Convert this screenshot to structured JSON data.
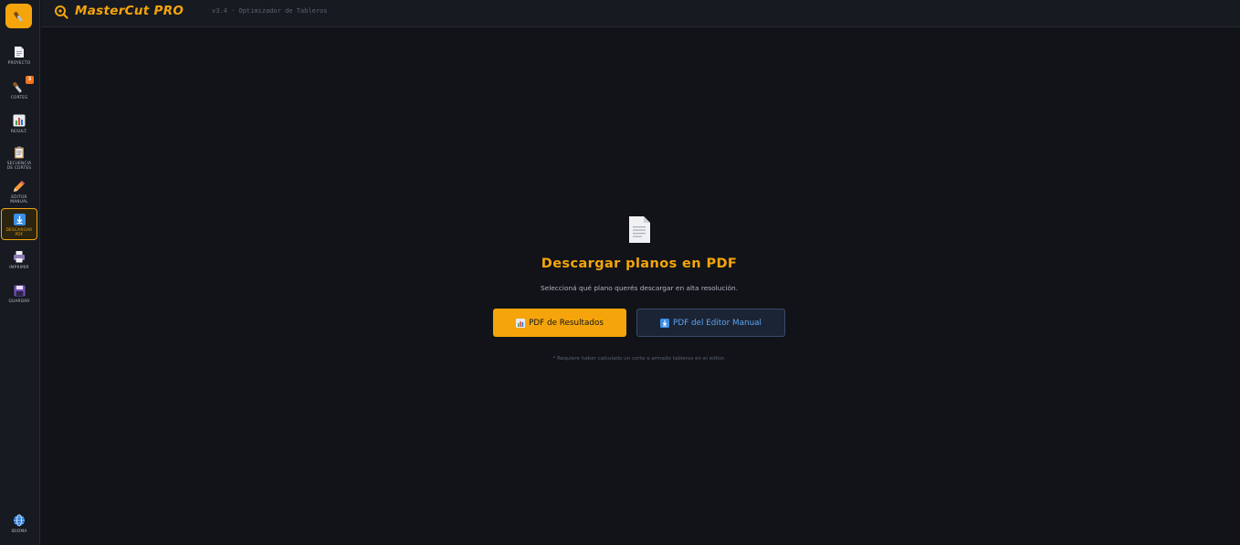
{
  "app": {
    "title": "MasterCut PRO",
    "version_subtitle": "v3.4 · Optimizador de Tableros"
  },
  "sidebar": {
    "items": [
      {
        "label": "PROYECTO",
        "icon": "document-icon"
      },
      {
        "label": "CORTES",
        "icon": "saw-icon",
        "badge": "3"
      },
      {
        "label": "RESULT.",
        "icon": "bar-chart-icon"
      },
      {
        "label": "SECUENCIA\nDE CORTES",
        "icon": "clipboard-icon"
      },
      {
        "label": "EDITOR\nMANUAL",
        "icon": "pencil-icon"
      },
      {
        "label": "DESCARGAR\nPDF",
        "icon": "download-icon",
        "active": true
      },
      {
        "label": "IMPRIMIR",
        "icon": "printer-icon"
      },
      {
        "label": "GUARDAR",
        "icon": "floppy-disk-icon"
      }
    ],
    "bottom_item": {
      "label": "IDIOMA",
      "icon": "globe-icon"
    }
  },
  "main": {
    "title": "Descargar planos en PDF",
    "subtitle": "Seleccioná qué plano querés descargar en alta resolución.",
    "primary_button": "PDF de Resultados",
    "secondary_button": "PDF del Editor Manual",
    "note": "* Requiere haber calculado un corte o armado tableros en el editor."
  },
  "colors": {
    "accent": "#f5a50b",
    "background": "#111318",
    "sidebar": "#171a21",
    "link_blue": "#5ba4f5",
    "badge": "#f5731b"
  }
}
